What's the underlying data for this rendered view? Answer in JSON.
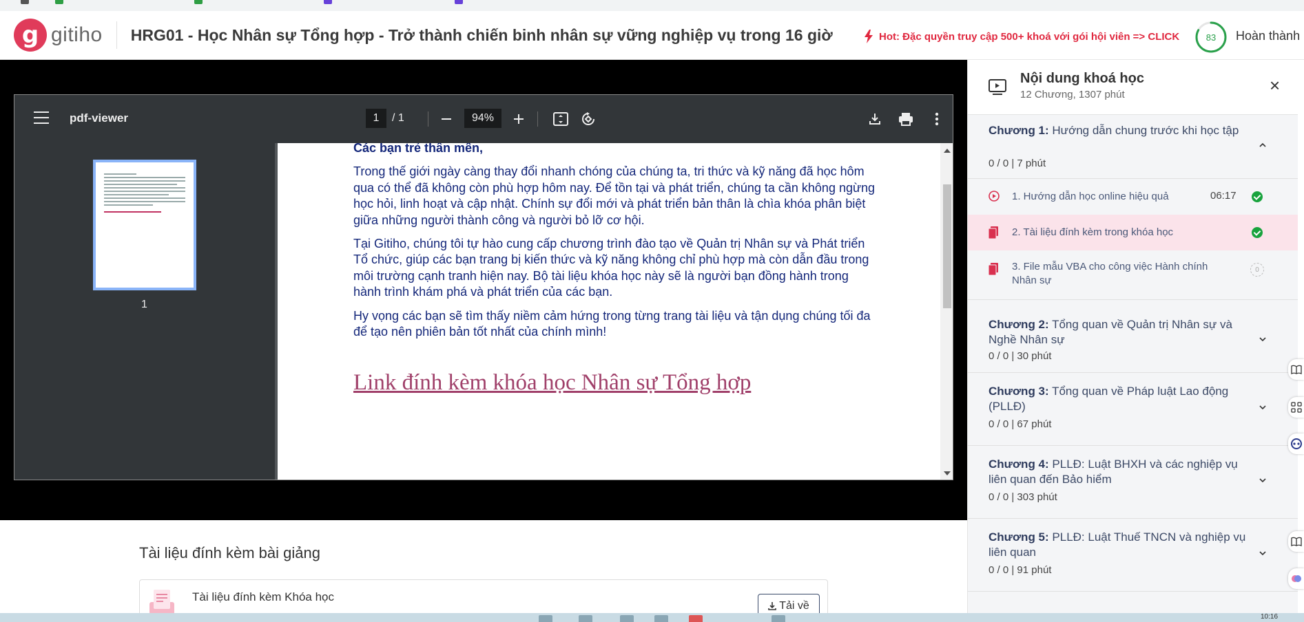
{
  "header": {
    "logo_text": "gitiho",
    "logo_letter": "g",
    "course_title": "HRG01 - Học Nhân sự Tổng hợp - Trở thành chiến binh nhân sự vững nghiệp vụ trong 16 giờ",
    "hot_text": "Hot: Đặc quyền truy cập 500+ khoá với gói hội viên => CLICK",
    "progress_value": "83",
    "progress_fraction": 0.83,
    "complete_label": "Hoàn thành",
    "accent_color": "#e03b5a",
    "progress_color": "#2aa14b"
  },
  "pdf_viewer": {
    "name": "pdf-viewer",
    "page_current": "1",
    "page_total": "/  1",
    "zoom": "94%",
    "thumbnail_number": "1",
    "greeting": "Các bạn trẻ thân mến,",
    "paragraphs": [
      "Trong thế giới ngày càng thay đổi nhanh chóng của chúng ta, tri thức và kỹ năng đã học hôm qua có thể đã không còn phù hợp hôm nay. Để tồn tại và phát triển, chúng ta cần không ngừng học hỏi, linh hoạt và cập nhật. Chính sự đổi mới và phát triển bản thân là chìa khóa phân biệt giữa những người thành công và người bỏ lỡ cơ hội.",
      "Tại Gitiho, chúng tôi tự hào cung cấp chương trình đào tạo về Quản trị Nhân sự và Phát triển Tổ chức, giúp các bạn trang bị kiến thức và kỹ năng không chỉ phù hợp mà còn dẫn đầu trong môi trường cạnh tranh hiện nay. Bộ tài liệu khóa học này sẽ là người bạn đồng hành trong hành trình khám phá và phát triển của các bạn.",
      "Hy vọng các bạn sẽ tìm thấy niềm cảm hứng trong từng trang tài liệu và tận dụng chúng tối đa để tạo nên phiên bản tốt nhất của chính mình!"
    ],
    "link_text": "Link đính kèm khóa học Nhân sự Tổng hợp"
  },
  "attachments": {
    "heading": "Tài liệu đính kèm bài giảng",
    "item_title": "Tài liệu đính kèm Khóa học",
    "download_label": "Tải về"
  },
  "sidebar": {
    "title": "Nội dung khoá học",
    "subtitle": "12 Chương, 1307 phút",
    "chapter1": {
      "prefix": "Chương 1:",
      "name": "Hướng dẫn chung trước khi học tập",
      "meta": "0 / 0   |   7 phút"
    },
    "lessons": [
      {
        "title": "1. Hướng dẫn học online hiệu quả",
        "duration": "06:17"
      },
      {
        "title": "2. Tài liệu đính kèm trong khóa học",
        "duration": ""
      },
      {
        "title": "3. File mẫu VBA cho công việc Hành chính Nhân sự",
        "duration": "",
        "zero": "0"
      }
    ],
    "chapter2": {
      "prefix": "Chương 2:",
      "name": "Tổng quan về Quản trị Nhân sự và Nghề Nhân sự",
      "meta": "0 / 0   |   30 phút"
    },
    "chapter3": {
      "prefix": "Chương 3:",
      "name": "Tổng quan về Pháp luật Lao động (PLLĐ)",
      "meta": "0 / 0   |   67 phút"
    },
    "chapter4": {
      "prefix": "Chương 4:",
      "name": "PLLĐ: Luật BHXH và các nghiệp vụ liên quan đến Bảo hiểm",
      "meta": "0 / 0   |   303 phút"
    },
    "chapter5": {
      "prefix": "Chương 5:",
      "name": "PLLĐ: Luật Thuế TNCN và nghiệp vụ liên quan",
      "meta": "0 / 0   |   91 phút"
    }
  },
  "taskbar": {
    "time": "10:16"
  }
}
